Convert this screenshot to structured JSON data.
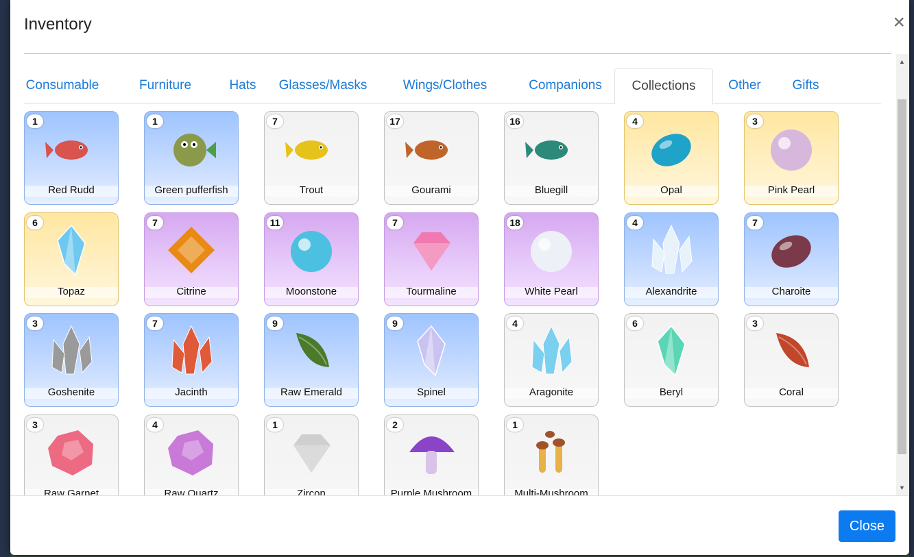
{
  "modal": {
    "title": "Inventory",
    "close_x": "×",
    "close_button": "Close"
  },
  "tabs": [
    {
      "label": "Consumable"
    },
    {
      "label": "Furniture"
    },
    {
      "label": "Hats"
    },
    {
      "label": "Glasses/Masks"
    },
    {
      "label": "Wings/Clothes"
    },
    {
      "label": "Companions"
    },
    {
      "label": "Collections"
    },
    {
      "label": "Other"
    },
    {
      "label": "Gifts"
    }
  ],
  "active_tab": "Collections",
  "items": [
    {
      "name": "Red Rudd",
      "count": "1",
      "bg": "blue",
      "icon": "fish-icon",
      "color": "#d9534f"
    },
    {
      "name": "Green pufferfish",
      "count": "1",
      "bg": "blue",
      "icon": "pufferfish-icon",
      "color": "#8a9a4a"
    },
    {
      "name": "Trout",
      "count": "7",
      "bg": "gray",
      "icon": "fish-icon",
      "color": "#e6c31a"
    },
    {
      "name": "Gourami",
      "count": "17",
      "bg": "gray",
      "icon": "fish-icon",
      "color": "#c0652a"
    },
    {
      "name": "Bluegill",
      "count": "16",
      "bg": "gray",
      "icon": "fish-icon",
      "color": "#2d8a7a"
    },
    {
      "name": "Opal",
      "count": "4",
      "bg": "gold",
      "icon": "gem-oval-icon",
      "color": "#1fa3c8"
    },
    {
      "name": "Pink Pearl",
      "count": "3",
      "bg": "gold",
      "icon": "pearl-icon",
      "color": "#d8b7dc"
    },
    {
      "name": "Topaz",
      "count": "6",
      "bg": "gold",
      "icon": "crystal-icon",
      "color": "#6ec8f0"
    },
    {
      "name": "Citrine",
      "count": "7",
      "bg": "purple",
      "icon": "gem-square-icon",
      "color": "#e88a14"
    },
    {
      "name": "Moonstone",
      "count": "11",
      "bg": "purple",
      "icon": "pearl-icon",
      "color": "#4cc0e0"
    },
    {
      "name": "Tourmaline",
      "count": "7",
      "bg": "purple",
      "icon": "gem-cut-icon",
      "color": "#f07ab0"
    },
    {
      "name": "White Pearl",
      "count": "18",
      "bg": "purple",
      "icon": "pearl-icon",
      "color": "#eef0f8"
    },
    {
      "name": "Alexandrite",
      "count": "4",
      "bg": "blue",
      "icon": "crystal-cluster-icon",
      "color": "#e8f2fa"
    },
    {
      "name": "Charoite",
      "count": "7",
      "bg": "blue",
      "icon": "gem-oval-icon",
      "color": "#7a3a4a"
    },
    {
      "name": "Goshenite",
      "count": "3",
      "bg": "blue",
      "icon": "crystal-cluster-icon",
      "color": "#9a9a9a"
    },
    {
      "name": "Jacinth",
      "count": "7",
      "bg": "blue",
      "icon": "crystal-cluster-icon",
      "color": "#e05a3a"
    },
    {
      "name": "Raw Emerald",
      "count": "9",
      "bg": "blue",
      "icon": "leaf-gem-icon",
      "color": "#4a7a2a"
    },
    {
      "name": "Spinel",
      "count": "9",
      "bg": "blue",
      "icon": "crystal-icon",
      "color": "#c9c3f2"
    },
    {
      "name": "Aragonite",
      "count": "4",
      "bg": "gray",
      "icon": "crystal-cluster-icon",
      "color": "#7ad0ee"
    },
    {
      "name": "Beryl",
      "count": "6",
      "bg": "gray",
      "icon": "crystal-icon",
      "color": "#5ad6b4"
    },
    {
      "name": "Coral",
      "count": "3",
      "bg": "gray",
      "icon": "leaf-gem-icon",
      "color": "#c2462a"
    },
    {
      "name": "Raw Garnet",
      "count": "3",
      "bg": "gray",
      "icon": "rough-gem-icon",
      "color": "#ec6a82"
    },
    {
      "name": "Raw Quartz",
      "count": "4",
      "bg": "gray",
      "icon": "rough-gem-icon",
      "color": "#c97ad8"
    },
    {
      "name": "Zircon",
      "count": "1",
      "bg": "gray",
      "icon": "gem-cut-icon",
      "color": "#cfcfcf"
    },
    {
      "name": "Purple Mushroom",
      "count": "2",
      "bg": "gray",
      "icon": "mushroom-icon",
      "color": "#8a44c8"
    },
    {
      "name": "Multi-Mushroom",
      "count": "1",
      "bg": "gray",
      "icon": "mushroom-cluster-icon",
      "color": "#e8b248"
    }
  ]
}
